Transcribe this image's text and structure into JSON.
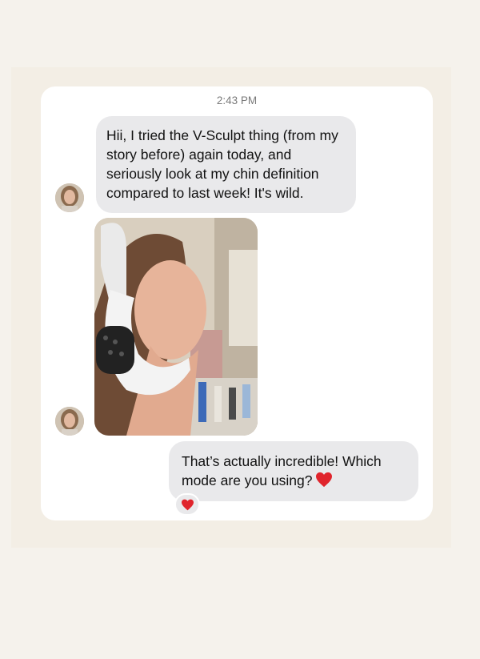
{
  "conversation": {
    "timestamp": "2:43 PM",
    "incoming_message": "Hii, I tried the V-Sculpt thing (from my story before) again today, and seriously look at my chin definition compared to last week! It's wild.",
    "outgoing_message": "That’s actually incredible! Which mode are you using?",
    "reaction": "heart-emoji-icon",
    "photo_description_icon": "photo-icon"
  },
  "colors": {
    "incoming_bubble": "#e9e9eb",
    "outgoing_bubble": "#e9e9eb",
    "heart": "#e0242c",
    "card_background": "#ffffff",
    "page_background": "#f5f2ec"
  }
}
